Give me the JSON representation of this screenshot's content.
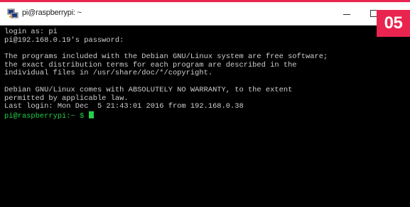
{
  "window": {
    "title": "pi@raspberrypi: ~",
    "icon": "putty-terminal-icon",
    "controls": {
      "minimize": "minimize-icon",
      "maximize": "maximize-icon"
    }
  },
  "badge": {
    "label": "05",
    "color": "#e8244f"
  },
  "terminal": {
    "background": "#000000",
    "text_color": "#cfcfcf",
    "prompt_color": "#22d04a",
    "lines": [
      "login as: pi",
      "pi@192.168.0.19's password:",
      "",
      "The programs included with the Debian GNU/Linux system are free software;",
      "the exact distribution terms for each program are described in the",
      "individual files in /usr/share/doc/*/copyright.",
      "",
      "Debian GNU/Linux comes with ABSOLUTELY NO WARRANTY, to the extent",
      "permitted by applicable law.",
      "Last login: Mon Dec  5 21:43:01 2016 from 192.168.0.38"
    ],
    "prompt": "pi@raspberrypi:~ $ "
  }
}
